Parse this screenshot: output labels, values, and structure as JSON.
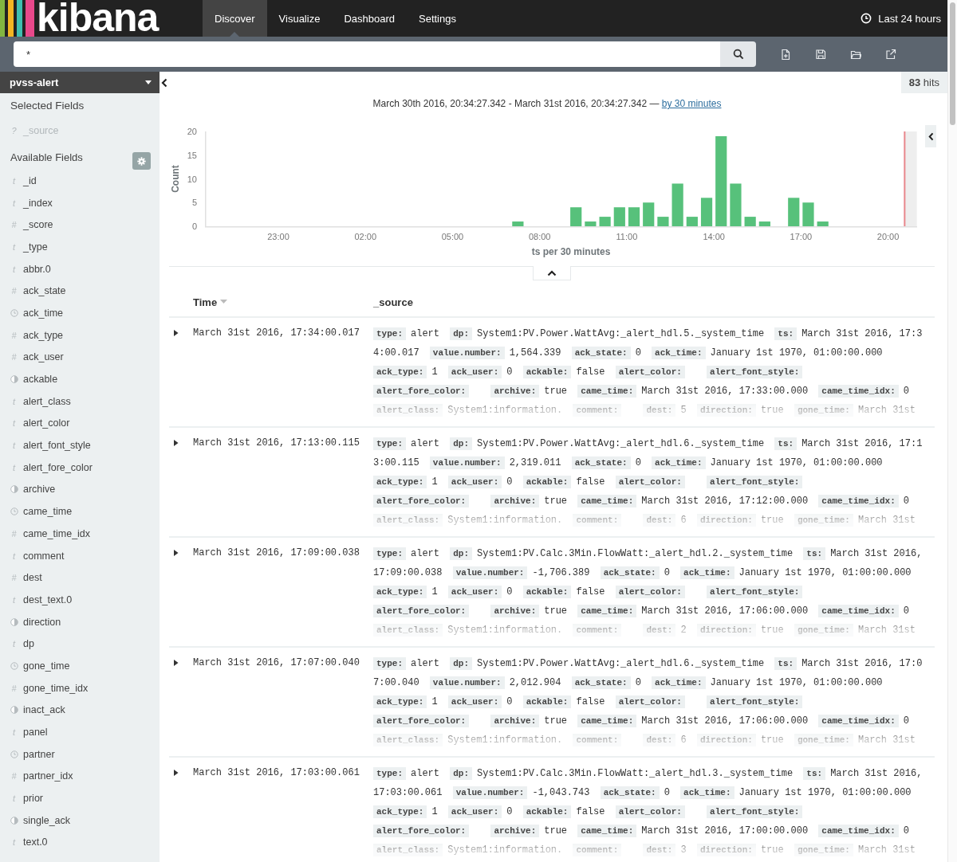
{
  "app": {
    "logo": "kibana",
    "nav": [
      {
        "label": "Discover",
        "selected": true
      },
      {
        "label": "Visualize",
        "selected": false
      },
      {
        "label": "Dashboard",
        "selected": false
      },
      {
        "label": "Settings",
        "selected": false
      }
    ],
    "timepicker": "Last 24 hours"
  },
  "search": {
    "value": "*"
  },
  "sidebar": {
    "index_pattern": "pvss-alert",
    "selected_title": "Selected Fields",
    "selected_fields": [
      {
        "name": "_source",
        "kind": "glyph",
        "glyph": "?"
      }
    ],
    "available_title": "Available Fields",
    "available_fields": [
      {
        "name": "_id",
        "kind": "glyph",
        "glyph": "t"
      },
      {
        "name": "_index",
        "kind": "glyph",
        "glyph": "t"
      },
      {
        "name": "_score",
        "kind": "glyph",
        "glyph": "#"
      },
      {
        "name": "_type",
        "kind": "glyph",
        "glyph": "t"
      },
      {
        "name": "abbr.0",
        "kind": "glyph",
        "glyph": "t"
      },
      {
        "name": "ack_state",
        "kind": "glyph",
        "glyph": "#"
      },
      {
        "name": "ack_time",
        "kind": "date"
      },
      {
        "name": "ack_type",
        "kind": "glyph",
        "glyph": "#"
      },
      {
        "name": "ack_user",
        "kind": "glyph",
        "glyph": "#"
      },
      {
        "name": "ackable",
        "kind": "boolean"
      },
      {
        "name": "alert_class",
        "kind": "glyph",
        "glyph": "t"
      },
      {
        "name": "alert_color",
        "kind": "glyph",
        "glyph": "t"
      },
      {
        "name": "alert_font_style",
        "kind": "glyph",
        "glyph": "t"
      },
      {
        "name": "alert_fore_color",
        "kind": "glyph",
        "glyph": "t"
      },
      {
        "name": "archive",
        "kind": "boolean"
      },
      {
        "name": "came_time",
        "kind": "date"
      },
      {
        "name": "came_time_idx",
        "kind": "glyph",
        "glyph": "#"
      },
      {
        "name": "comment",
        "kind": "glyph",
        "glyph": "t"
      },
      {
        "name": "dest",
        "kind": "glyph",
        "glyph": "#"
      },
      {
        "name": "dest_text.0",
        "kind": "glyph",
        "glyph": "t"
      },
      {
        "name": "direction",
        "kind": "boolean"
      },
      {
        "name": "dp",
        "kind": "glyph",
        "glyph": "t"
      },
      {
        "name": "gone_time",
        "kind": "date"
      },
      {
        "name": "gone_time_idx",
        "kind": "glyph",
        "glyph": "#"
      },
      {
        "name": "inact_ack",
        "kind": "boolean"
      },
      {
        "name": "panel",
        "kind": "glyph",
        "glyph": "t"
      },
      {
        "name": "partner",
        "kind": "date"
      },
      {
        "name": "partner_idx",
        "kind": "glyph",
        "glyph": "#"
      },
      {
        "name": "prior",
        "kind": "glyph",
        "glyph": "t"
      },
      {
        "name": "single_ack",
        "kind": "boolean"
      },
      {
        "name": "text.0",
        "kind": "glyph",
        "glyph": "t"
      }
    ]
  },
  "hits": "**83** hits",
  "histogram": {
    "range": "March 30th 2016, 20:34:27.342 - March 31st 2016, 20:34:27.342 —",
    "interval_link": "by 30 minutes",
    "chart_data": {
      "type": "bar",
      "xlabel": "ts per 30 minutes",
      "ylabel": "Count",
      "categories": [
        null,
        null,
        null,
        null,
        null,
        "23:00",
        null,
        null,
        null,
        null,
        null,
        "02:00",
        null,
        null,
        null,
        null,
        null,
        "05:00",
        null,
        null,
        null,
        null,
        null,
        "08:00",
        null,
        null,
        null,
        null,
        null,
        "11:00",
        null,
        null,
        null,
        null,
        null,
        "14:00",
        null,
        null,
        null,
        null,
        null,
        "17:00",
        null,
        null,
        null,
        null,
        null,
        "20:00",
        null
      ],
      "series": [
        {
          "color": "#57c17b",
          "values": [
            0,
            0,
            0,
            0,
            0,
            0,
            0,
            0,
            0,
            0,
            0,
            0,
            0,
            0,
            0,
            0,
            0,
            0,
            0,
            0,
            0,
            1,
            0,
            0,
            0,
            4,
            1,
            2,
            4,
            4,
            5,
            2,
            9,
            2,
            6,
            19,
            9,
            2,
            1,
            0,
            6,
            5,
            1,
            0,
            0,
            0,
            0,
            0,
            0
          ]
        }
      ],
      "ylim": [
        0,
        20
      ],
      "yticks": [
        0,
        5,
        10,
        15,
        20
      ]
    }
  },
  "table": {
    "columns": [
      {
        "label": "Time",
        "sorted": true
      },
      {
        "label": "_source",
        "sorted": false
      }
    ],
    "rows": [
      {
        "time": "March 31st 2016, 17:34:00.017",
        "fields": [
          {
            "key": "type:",
            "value": "alert"
          },
          {
            "key": "dp:",
            "value": "System1:PV.Power.WattAvg:_alert_hdl.5._system_time"
          },
          {
            "key": "ts:",
            "value": "March 31st 2016, 17:34:00.017"
          },
          {
            "key": "value.number:",
            "value": "1,564.339"
          },
          {
            "key": "ack_state:",
            "value": "0"
          },
          {
            "key": "ack_time:",
            "value": "January 1st 1970, 01:00:00.000"
          },
          {
            "key": "ack_type:",
            "value": "1"
          },
          {
            "key": "ack_user:",
            "value": "0"
          },
          {
            "key": "ackable:",
            "value": "false"
          },
          {
            "key": "alert_color:"
          },
          {
            "key": "alert_font_style:"
          },
          {
            "key": "alert_fore_color:"
          },
          {
            "key": "archive:",
            "value": "true"
          },
          {
            "key": "came_time:",
            "value": "March 31st 2016, 17:33:00.000"
          },
          {
            "key": "came_time_idx:",
            "value": "0"
          },
          {
            "key": "alert_class:",
            "value": "System1:information."
          },
          {
            "key": "comment:"
          },
          {
            "key": "dest:",
            "value": "5"
          },
          {
            "key": "direction:",
            "value": "true"
          },
          {
            "key": "gone_time:",
            "value": "March 31st"
          }
        ]
      },
      {
        "time": "March 31st 2016, 17:13:00.115",
        "fields": [
          {
            "key": "type:",
            "value": "alert"
          },
          {
            "key": "dp:",
            "value": "System1:PV.Power.WattAvg:_alert_hdl.6._system_time"
          },
          {
            "key": "ts:",
            "value": "March 31st 2016, 17:13:00.115"
          },
          {
            "key": "value.number:",
            "value": "2,319.011"
          },
          {
            "key": "ack_state:",
            "value": "0"
          },
          {
            "key": "ack_time:",
            "value": "January 1st 1970, 01:00:00.000"
          },
          {
            "key": "ack_type:",
            "value": "1"
          },
          {
            "key": "ack_user:",
            "value": "0"
          },
          {
            "key": "ackable:",
            "value": "false"
          },
          {
            "key": "alert_color:"
          },
          {
            "key": "alert_font_style:"
          },
          {
            "key": "alert_fore_color:"
          },
          {
            "key": "archive:",
            "value": "true"
          },
          {
            "key": "came_time:",
            "value": "March 31st 2016, 17:12:00.000"
          },
          {
            "key": "came_time_idx:",
            "value": "0"
          },
          {
            "key": "alert_class:",
            "value": "System1:information."
          },
          {
            "key": "comment:"
          },
          {
            "key": "dest:",
            "value": "6"
          },
          {
            "key": "direction:",
            "value": "true"
          },
          {
            "key": "gone_time:",
            "value": "March 31st"
          }
        ]
      },
      {
        "time": "March 31st 2016, 17:09:00.038",
        "fields": [
          {
            "key": "type:",
            "value": "alert"
          },
          {
            "key": "dp:",
            "value": "System1:PV.Calc.3Min.FlowWatt:_alert_hdl.2._system_time"
          },
          {
            "key": "ts:",
            "value": "March 31st 2016, 17:09:00.038"
          },
          {
            "key": "value.number:",
            "value": "-1,706.389"
          },
          {
            "key": "ack_state:",
            "value": "0"
          },
          {
            "key": "ack_time:",
            "value": "January 1st 1970, 01:00:00.000"
          },
          {
            "key": "ack_type:",
            "value": "1"
          },
          {
            "key": "ack_user:",
            "value": "0"
          },
          {
            "key": "ackable:",
            "value": "false"
          },
          {
            "key": "alert_color:"
          },
          {
            "key": "alert_font_style:"
          },
          {
            "key": "alert_fore_color:"
          },
          {
            "key": "archive:",
            "value": "true"
          },
          {
            "key": "came_time:",
            "value": "March 31st 2016, 17:06:00.000"
          },
          {
            "key": "came_time_idx:",
            "value": "0"
          },
          {
            "key": "alert_class:",
            "value": "System1:information."
          },
          {
            "key": "comment:"
          },
          {
            "key": "dest:",
            "value": "2"
          },
          {
            "key": "direction:",
            "value": "true"
          },
          {
            "key": "gone_time:",
            "value": "March 31st"
          }
        ]
      },
      {
        "time": "March 31st 2016, 17:07:00.040",
        "fields": [
          {
            "key": "type:",
            "value": "alert"
          },
          {
            "key": "dp:",
            "value": "System1:PV.Power.WattAvg:_alert_hdl.6._system_time"
          },
          {
            "key": "ts:",
            "value": "March 31st 2016, 17:07:00.040"
          },
          {
            "key": "value.number:",
            "value": "2,012.904"
          },
          {
            "key": "ack_state:",
            "value": "0"
          },
          {
            "key": "ack_time:",
            "value": "January 1st 1970, 01:00:00.000"
          },
          {
            "key": "ack_type:",
            "value": "1"
          },
          {
            "key": "ack_user:",
            "value": "0"
          },
          {
            "key": "ackable:",
            "value": "false"
          },
          {
            "key": "alert_color:"
          },
          {
            "key": "alert_font_style:"
          },
          {
            "key": "alert_fore_color:"
          },
          {
            "key": "archive:",
            "value": "true"
          },
          {
            "key": "came_time:",
            "value": "March 31st 2016, 17:06:00.000"
          },
          {
            "key": "came_time_idx:",
            "value": "0"
          },
          {
            "key": "alert_class:",
            "value": "System1:information."
          },
          {
            "key": "comment:"
          },
          {
            "key": "dest:",
            "value": "6"
          },
          {
            "key": "direction:",
            "value": "true"
          },
          {
            "key": "gone_time:",
            "value": "March 31st"
          }
        ]
      },
      {
        "time": "March 31st 2016, 17:03:00.061",
        "fields": [
          {
            "key": "type:",
            "value": "alert"
          },
          {
            "key": "dp:",
            "value": "System1:PV.Calc.3Min.FlowWatt:_alert_hdl.3._system_time"
          },
          {
            "key": "ts:",
            "value": "March 31st 2016, 17:03:00.061"
          },
          {
            "key": "value.number:",
            "value": "-1,043.743"
          },
          {
            "key": "ack_state:",
            "value": "0"
          },
          {
            "key": "ack_time:",
            "value": "January 1st 1970, 01:00:00.000"
          },
          {
            "key": "ack_type:",
            "value": "1"
          },
          {
            "key": "ack_user:",
            "value": "0"
          },
          {
            "key": "ackable:",
            "value": "false"
          },
          {
            "key": "alert_color:"
          },
          {
            "key": "alert_font_style:"
          },
          {
            "key": "alert_fore_color:"
          },
          {
            "key": "archive:",
            "value": "true"
          },
          {
            "key": "came_time:",
            "value": "March 31st 2016, 17:00:00.000"
          },
          {
            "key": "came_time_idx:",
            "value": "0"
          },
          {
            "key": "alert_class:",
            "value": "System1:information."
          },
          {
            "key": "comment:"
          },
          {
            "key": "dest:",
            "value": "3"
          },
          {
            "key": "direction:",
            "value": "true"
          },
          {
            "key": "gone_time:",
            "value": "March 31st"
          }
        ]
      }
    ]
  }
}
